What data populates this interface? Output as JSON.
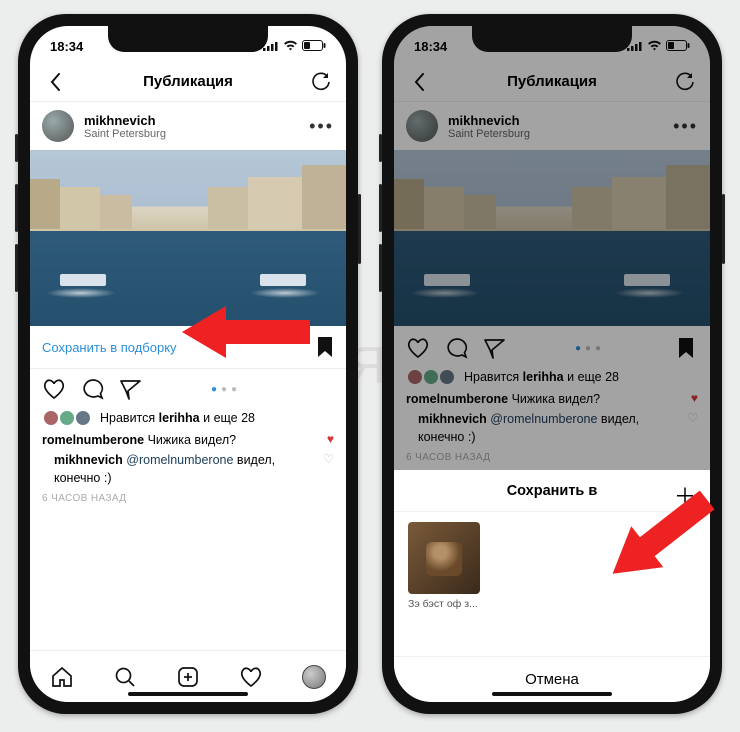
{
  "statusbar": {
    "time": "18:34"
  },
  "navbar": {
    "title": "Публикация"
  },
  "post": {
    "username": "mikhnevich",
    "location": "Saint Petersburg"
  },
  "save_link": "Сохранить в подборку",
  "likes": {
    "prefix": "Нравится ",
    "user": "lerihha",
    "suffix": " и еще 28"
  },
  "comment1": {
    "user": "romelnumberone",
    "text": " Чижика видел?"
  },
  "comment2": {
    "user": "mikhnevich",
    "mention": "@romelnumberone",
    "text": " видел, конечно :)"
  },
  "timeago": "6 ЧАСОВ НАЗАД",
  "sheet": {
    "title": "Сохранить в",
    "collection_name": "Зэ бэст оф з...",
    "cancel": "Отмена"
  },
  "watermark": "Я"
}
